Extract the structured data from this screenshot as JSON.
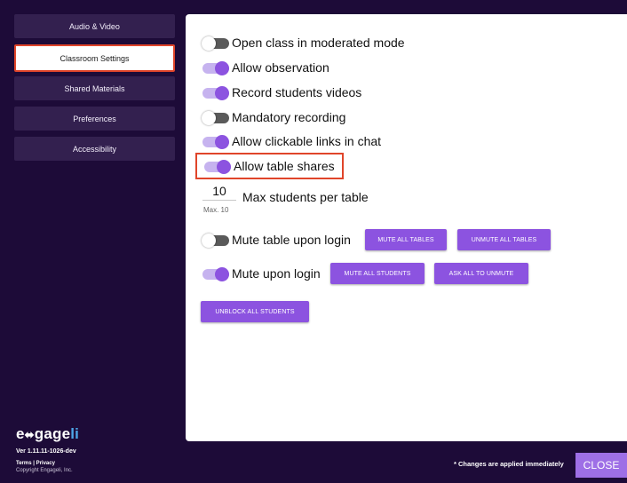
{
  "sidebar": {
    "items": [
      {
        "label": "Audio & Video"
      },
      {
        "label": "Classroom Settings"
      },
      {
        "label": "Shared Materials"
      },
      {
        "label": "Preferences"
      },
      {
        "label": "Accessibility"
      }
    ],
    "logo": {
      "text_a": "e",
      "text_b": "gage",
      "text_c": "li"
    },
    "version": "Ver 1.11.11-1026-dev",
    "terms": "Terms | Privacy",
    "copyright": "Copyright Engageli, Inc."
  },
  "settings": {
    "toggles": [
      {
        "label": "Open class in moderated mode",
        "state": "off"
      },
      {
        "label": "Allow observation",
        "state": "on"
      },
      {
        "label": "Record students videos",
        "state": "on"
      },
      {
        "label": "Mandatory recording",
        "state": "off"
      },
      {
        "label": "Allow clickable links in chat",
        "state": "on"
      },
      {
        "label": "Allow table shares",
        "state": "on"
      }
    ],
    "max_students": {
      "value": "10",
      "hint": "Max. 10",
      "label": "Max students per table"
    },
    "mute_table": {
      "label": "Mute table upon login",
      "state": "off"
    },
    "mute_login": {
      "label": "Mute upon login",
      "state": "on"
    },
    "buttons": {
      "mute_all_tables": "MUTE ALL TABLES",
      "unmute_all_tables": "UNMUTE ALL TABLES",
      "mute_all_students": "MUTE ALL STUDENTS",
      "ask_all_unmute": "ASK ALL TO UNMUTE",
      "unblock_all_students": "UNBLOCK ALL STUDENTS"
    }
  },
  "footer": {
    "note": "* Changes are applied immediately",
    "close_label": "CLOSE"
  },
  "colors": {
    "background": "#1d0b38",
    "accent": "#8c53e0",
    "highlight": "#e0452a"
  }
}
